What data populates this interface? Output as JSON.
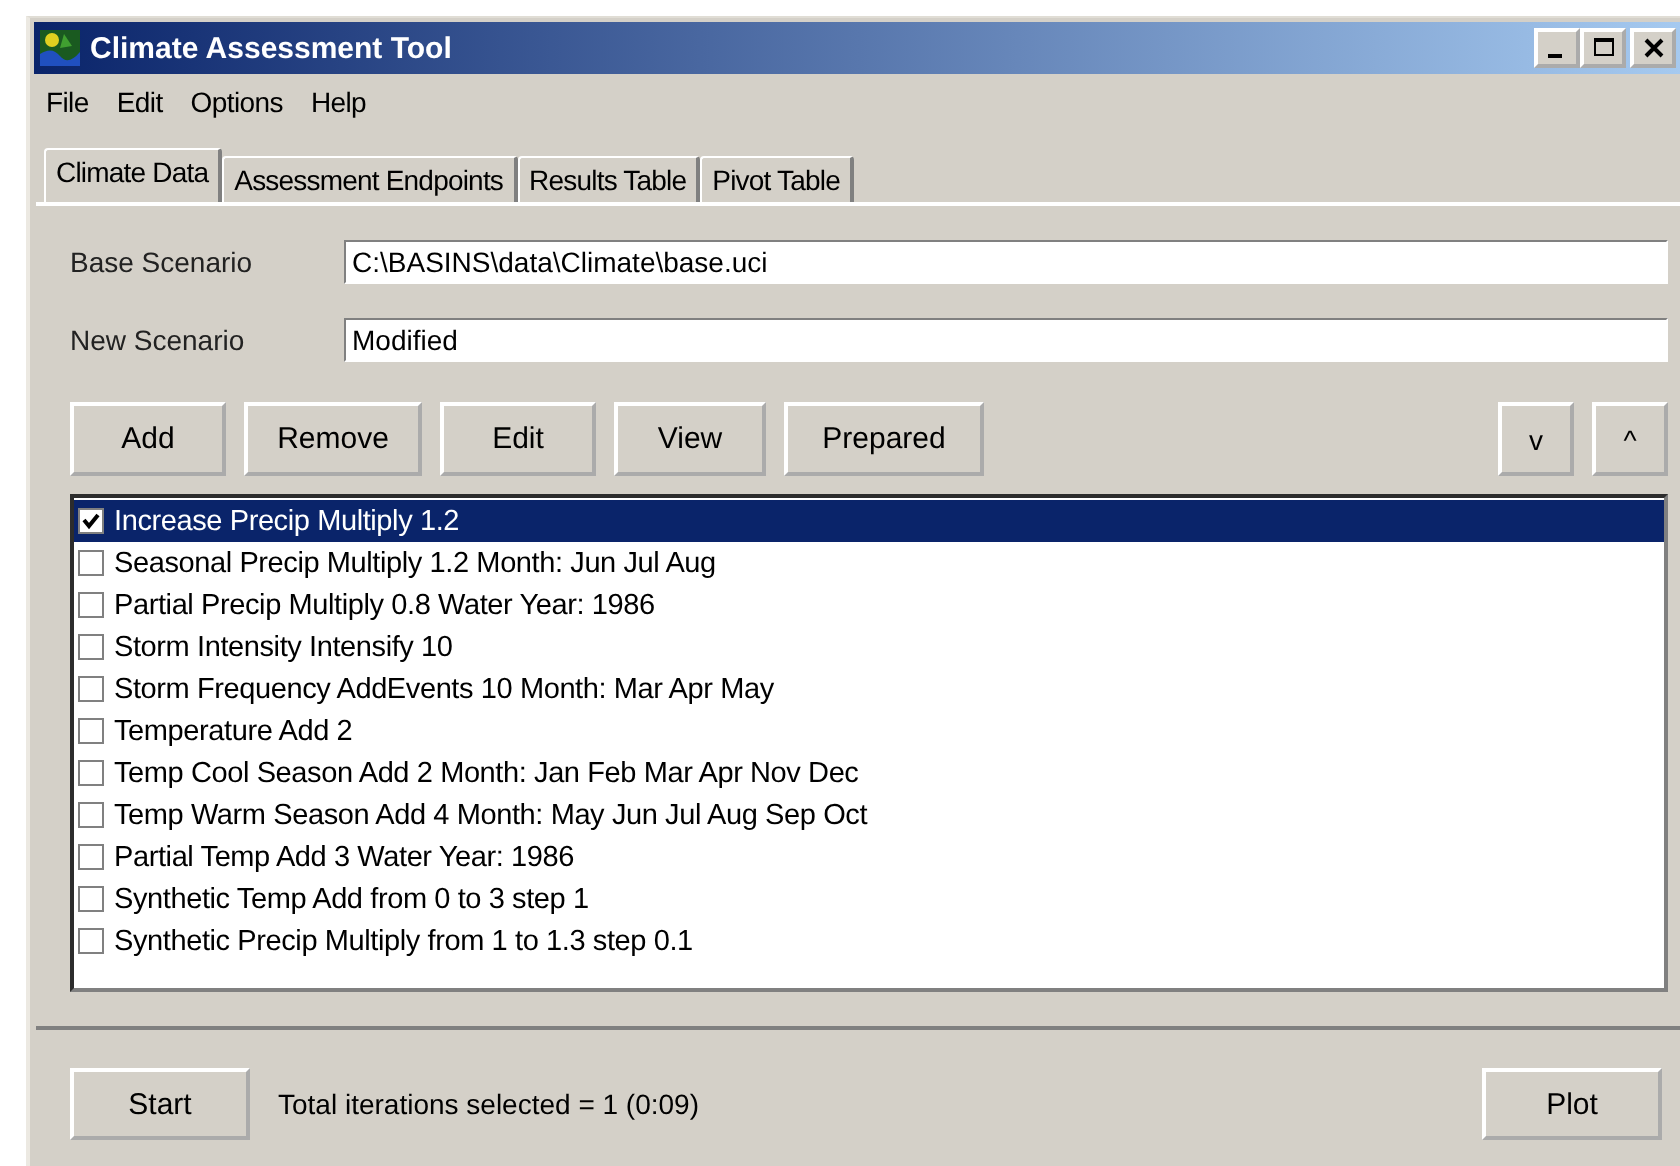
{
  "window": {
    "title": "Climate Assessment Tool"
  },
  "menu": [
    "File",
    "Edit",
    "Options",
    "Help"
  ],
  "tabs": [
    {
      "label": "Climate Data",
      "selected": true
    },
    {
      "label": "Assessment Endpoints",
      "selected": false
    },
    {
      "label": "Results Table",
      "selected": false
    },
    {
      "label": "Pivot Table",
      "selected": false
    }
  ],
  "fields": [
    {
      "label": "Base Scenario",
      "value": "C:\\BASINS\\data\\Climate\\base.uci"
    },
    {
      "label": "New Scenario",
      "value": "Modified"
    }
  ],
  "buttons": [
    "Add",
    "Remove",
    "Edit",
    "View",
    "Prepared"
  ],
  "order_buttons": [
    "v",
    "^"
  ],
  "scenarios": [
    {
      "text": "Increase Precip Multiply 1.2",
      "checked": true,
      "selected": true
    },
    {
      "text": "Seasonal Precip Multiply 1.2 Month: Jun Jul Aug",
      "checked": false,
      "selected": false
    },
    {
      "text": "Partial Precip Multiply 0.8 Water Year: 1986",
      "checked": false,
      "selected": false
    },
    {
      "text": "Storm Intensity Intensify 10",
      "checked": false,
      "selected": false
    },
    {
      "text": "Storm Frequency AddEvents 10 Month: Mar Apr May",
      "checked": false,
      "selected": false
    },
    {
      "text": "Temperature Add 2",
      "checked": false,
      "selected": false
    },
    {
      "text": "Temp Cool Season Add 2 Month: Jan Feb Mar Apr Nov Dec",
      "checked": false,
      "selected": false
    },
    {
      "text": "Temp Warm Season Add 4 Month: May Jun Jul Aug Sep Oct",
      "checked": false,
      "selected": false
    },
    {
      "text": "Partial Temp Add 3 Water Year: 1986",
      "checked": false,
      "selected": false
    },
    {
      "text": "Synthetic Temp Add from 0 to 3 step 1",
      "checked": false,
      "selected": false
    },
    {
      "text": "Synthetic Precip Multiply from 1 to 1.3 step 0.1",
      "checked": false,
      "selected": false
    }
  ],
  "footer": {
    "start": "Start",
    "status": "Total iterations selected = 1 (0:09)",
    "plot": "Plot"
  }
}
